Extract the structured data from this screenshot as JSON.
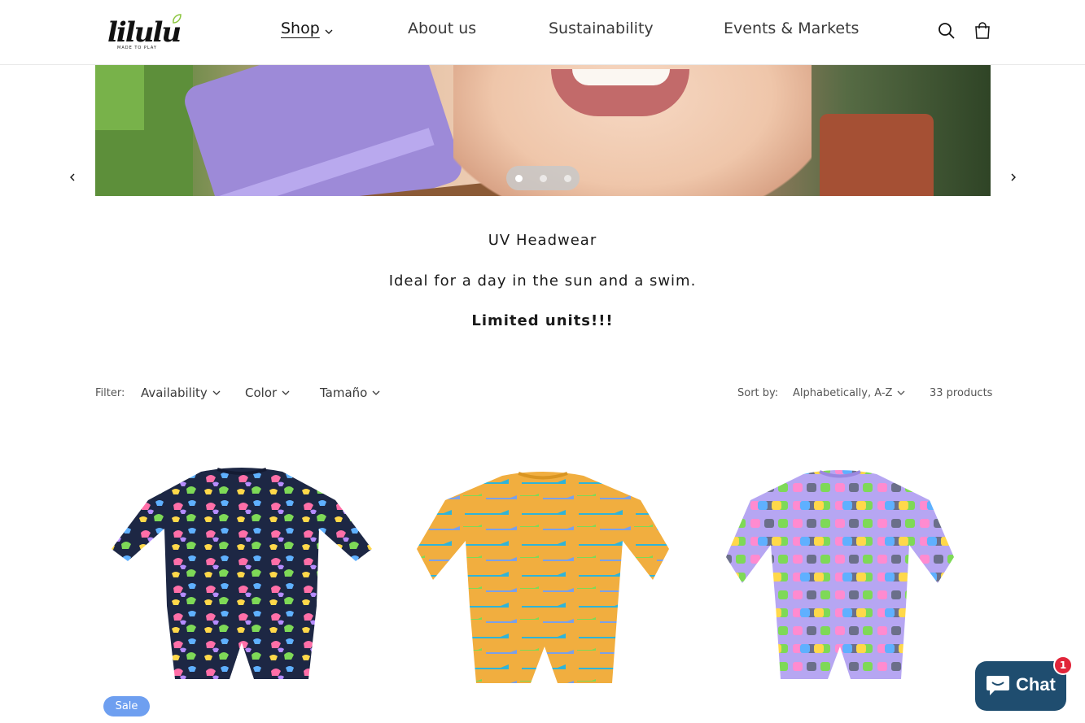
{
  "header": {
    "logo_text": "lilulu",
    "logo_tagline": "MADE TO PLAY",
    "nav": [
      {
        "label": "Shop",
        "active": true,
        "has_dropdown": true
      },
      {
        "label": "About us",
        "active": false
      },
      {
        "label": "Sustainability",
        "active": false
      },
      {
        "label": "Events & Markets",
        "active": false
      }
    ],
    "icons": {
      "search": "search-icon",
      "cart": "cart-icon"
    }
  },
  "slideshow": {
    "current_slide": 1,
    "total_slides": 3,
    "text": {
      "title": "UV Headwear",
      "subtitle": "Ideal for a day in the sun and a swim.",
      "note": "Limited units!!!"
    }
  },
  "filters": {
    "label": "Filter:",
    "items": [
      {
        "label": "Availability"
      },
      {
        "label": "Color"
      },
      {
        "label": "Tamaño"
      }
    ],
    "sort_label": "Sort by:",
    "sort_value": "Alphabetically, A-Z",
    "product_count": "33 products"
  },
  "products": [
    {
      "pattern": "navy-toucans",
      "badge": "Sale"
    },
    {
      "pattern": "yellow-crocodiles",
      "badge": ""
    },
    {
      "pattern": "lilac-elephants",
      "badge": ""
    }
  ],
  "chat": {
    "label": "Chat",
    "unread": "1"
  },
  "colors": {
    "sale_badge": "#6e9ff0",
    "chat_bg": "#1f4d6f",
    "chat_badge": "#e1253a",
    "navy_suit": "#1d2744",
    "yellow_suit": "#f1ae3f",
    "lilac_suit": "#b6a6f2"
  }
}
